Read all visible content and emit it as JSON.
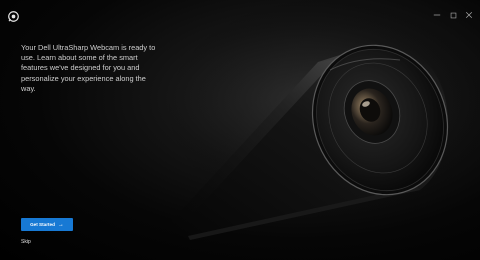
{
  "app": {
    "logo_icon": "webcam-logo-icon"
  },
  "window": {
    "minimize_icon": "minimize-icon",
    "maximize_icon": "maximize-icon",
    "close_icon": "close-icon"
  },
  "intro": {
    "text": "Your Dell UltraSharp Webcam is ready to use. Learn about some of the smart features we've designed for you and personalize your experience along the way."
  },
  "actions": {
    "get_started_label": "Get Started",
    "get_started_arrow": "→",
    "skip_label": "Skip"
  },
  "colors": {
    "accent": "#1779d4",
    "background": "#000000",
    "text": "#cfcfcf"
  }
}
